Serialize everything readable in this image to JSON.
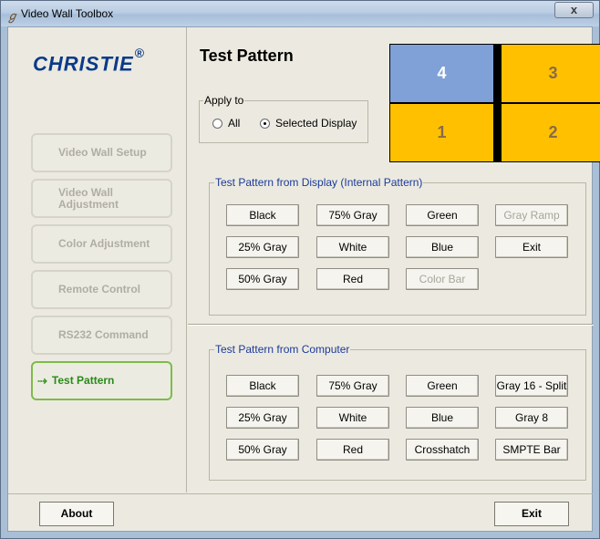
{
  "window": {
    "title": "Video Wall Toolbox",
    "close_label": "x",
    "app_icon": "app-icon"
  },
  "sidebar": {
    "logo": "CHRISTIE",
    "logo_mark": "®",
    "items": [
      {
        "label": "Video Wall Setup",
        "active": false
      },
      {
        "label": "Video Wall Adjustment",
        "active": false
      },
      {
        "label": "Color Adjustment",
        "active": false
      },
      {
        "label": "Remote Control",
        "active": false
      },
      {
        "label": "RS232 Command",
        "active": false
      },
      {
        "label": "Test Pattern",
        "active": true
      }
    ]
  },
  "main": {
    "title": "Test Pattern",
    "apply_to": {
      "legend": "Apply to",
      "options": [
        "All",
        "Selected Display"
      ],
      "selected": "Selected Display"
    },
    "display_grid": [
      "4",
      "3",
      "1",
      "2"
    ],
    "display_colors": {
      "selected": "#7fa1d8",
      "normal": "#ffc000"
    },
    "internal": {
      "legend": "Test Pattern from Display (Internal Pattern)",
      "buttons": [
        [
          "Black",
          "75% Gray",
          "Green",
          "Gray Ramp"
        ],
        [
          "25% Gray",
          "White",
          "Blue",
          "Exit"
        ],
        [
          "50% Gray",
          "Red",
          "Color Bar",
          ""
        ]
      ],
      "disabled": [
        "Gray Ramp",
        "Color Bar"
      ]
    },
    "computer": {
      "legend": "Test Pattern from Computer",
      "buttons": [
        [
          "Black",
          "75% Gray",
          "Green",
          "Gray 16 - Split"
        ],
        [
          "25% Gray",
          "White",
          "Blue",
          "Gray 8"
        ],
        [
          "50% Gray",
          "Red",
          "Crosshatch",
          "SMPTE Bar"
        ]
      ]
    }
  },
  "footer": {
    "about_label": "About",
    "exit_label": "Exit"
  }
}
